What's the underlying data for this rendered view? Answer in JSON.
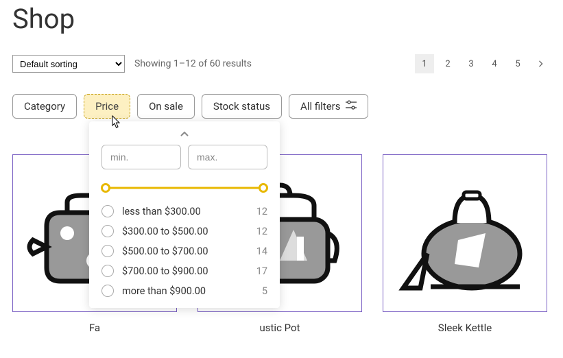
{
  "header": {
    "title": "Shop"
  },
  "toolbar": {
    "sort_label": "Default sorting",
    "result_text": "Showing 1–12 of 60 results"
  },
  "pagination": {
    "pages": [
      "1",
      "2",
      "3",
      "4",
      "5"
    ],
    "current": "1"
  },
  "filters": {
    "category": "Category",
    "price": "Price",
    "on_sale": "On sale",
    "stock_status": "Stock status",
    "all_filters": "All filters"
  },
  "price_panel": {
    "min_placeholder": "min.",
    "max_placeholder": "max.",
    "options": [
      {
        "label": "less than $300.00",
        "count": "12"
      },
      {
        "label": "$300.00 to $500.00",
        "count": "12"
      },
      {
        "label": "$500.00 to $700.00",
        "count": "14"
      },
      {
        "label": "$700.00 to $900.00",
        "count": "17"
      },
      {
        "label": "more than $900.00",
        "count": "5"
      }
    ]
  },
  "products": [
    {
      "title": "Fa",
      "sub": ""
    },
    {
      "title": "ustic Pot",
      "sub": ""
    },
    {
      "title": "Sleek Kettle",
      "sub": ""
    }
  ]
}
